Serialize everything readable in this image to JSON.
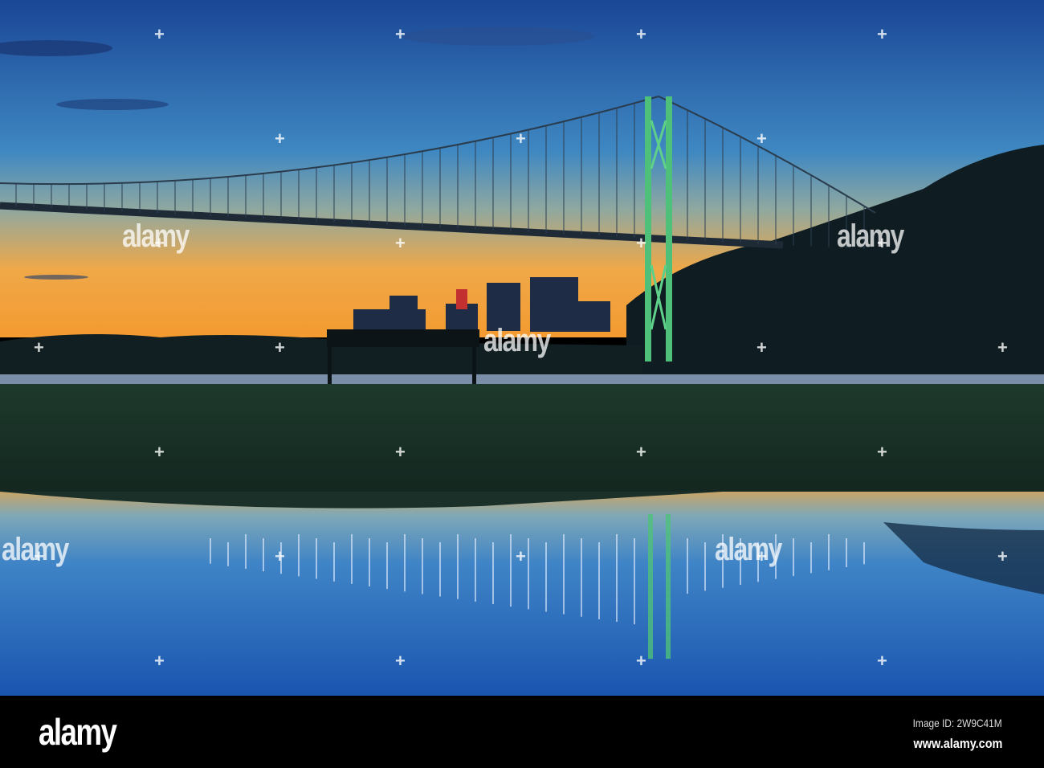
{
  "photo": {
    "subject": "Lions Gate Bridge at dusk with reflection",
    "colors": {
      "sky_top": "#1c4a9a",
      "sky_mid": "#3d86c4",
      "horizon": "#f2a23c",
      "trees": "#0f1e22",
      "grass": "#1c3128",
      "tower": "#5fd08a"
    }
  },
  "watermark": {
    "text": "alamy"
  },
  "footer": {
    "logo": "alamy",
    "image_id": "Image ID: 2W9C41M",
    "url": "www.alamy.com"
  }
}
